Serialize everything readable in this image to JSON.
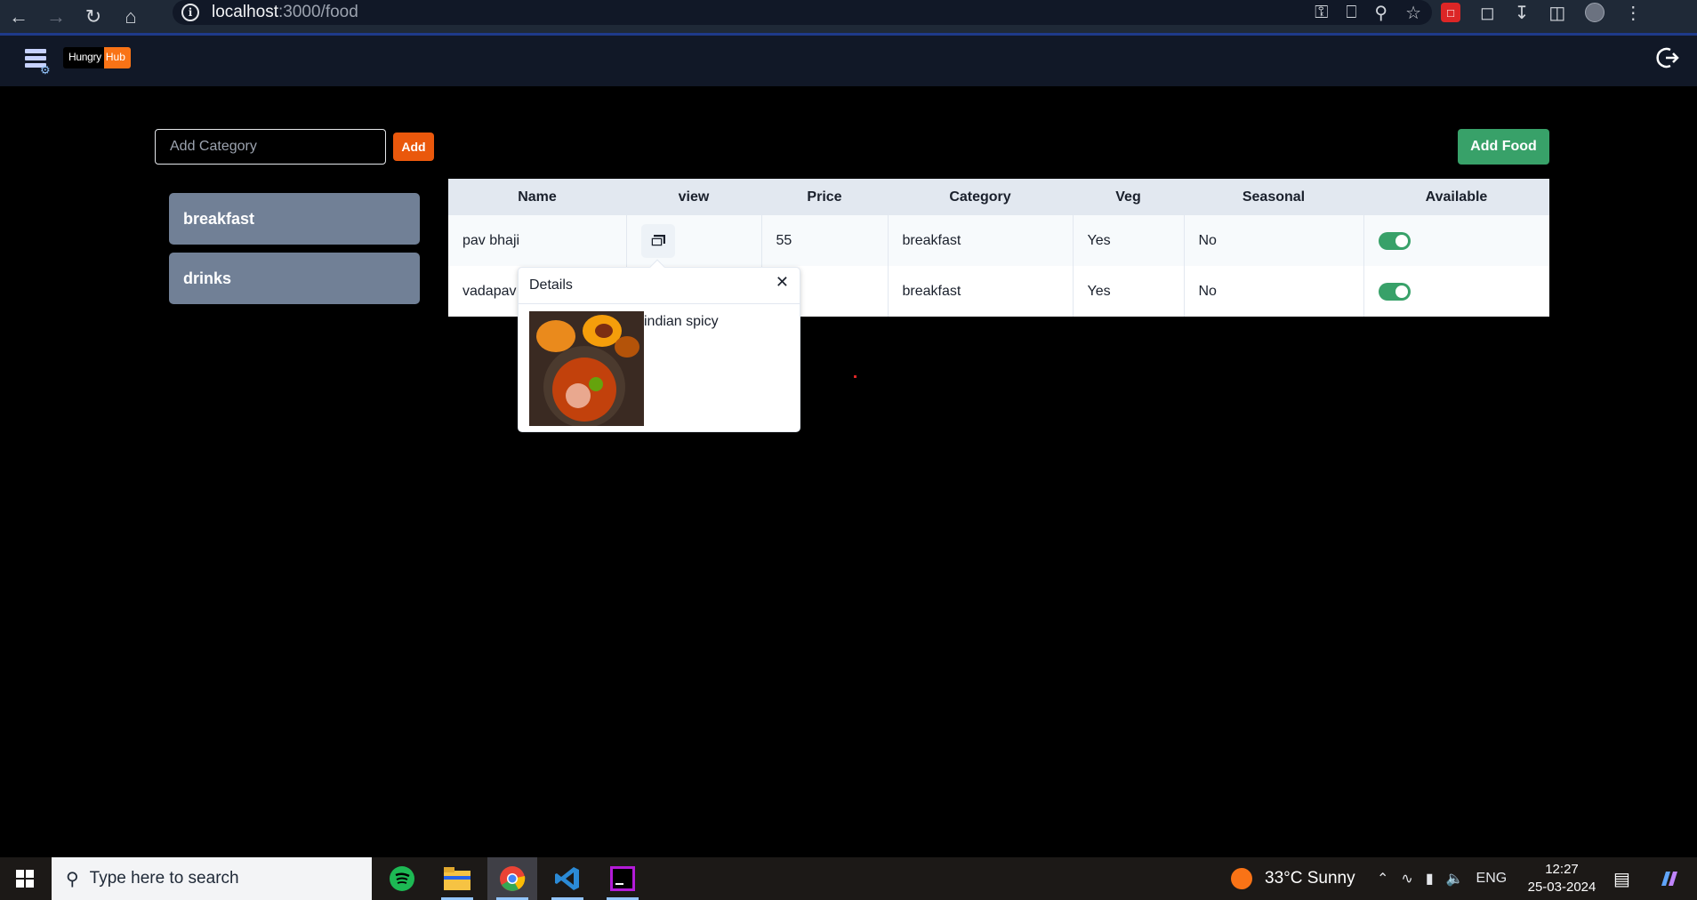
{
  "browser": {
    "url_host": "localhost",
    "url_path": ":3000/food"
  },
  "app": {
    "logo_part1": "Hungry",
    "logo_part2": "Hub"
  },
  "category_form": {
    "placeholder": "Add Category",
    "add_label": "Add"
  },
  "add_food_label": "Add Food",
  "categories": [
    {
      "label": "breakfast"
    },
    {
      "label": "drinks"
    }
  ],
  "table": {
    "headers": [
      "Name",
      "view",
      "Price",
      "Category",
      "Veg",
      "Seasonal",
      "Available"
    ],
    "rows": [
      {
        "name": "pav bhaji",
        "price": "55",
        "category": "breakfast",
        "veg": "Yes",
        "seasonal": "No",
        "available": true
      },
      {
        "name": "vadapav",
        "price": "",
        "category": "breakfast",
        "veg": "Yes",
        "seasonal": "No",
        "available": true
      }
    ]
  },
  "popover": {
    "title": "Details",
    "description": "indian spicy"
  },
  "taskbar": {
    "search_text": "Type here to search",
    "weather": "33°C  Sunny",
    "language": "ENG",
    "time": "12:27",
    "date": "25-03-2024"
  },
  "colors": {
    "accent_orange": "#ea580c",
    "accent_green": "#38a169",
    "category_bg": "#718096"
  }
}
